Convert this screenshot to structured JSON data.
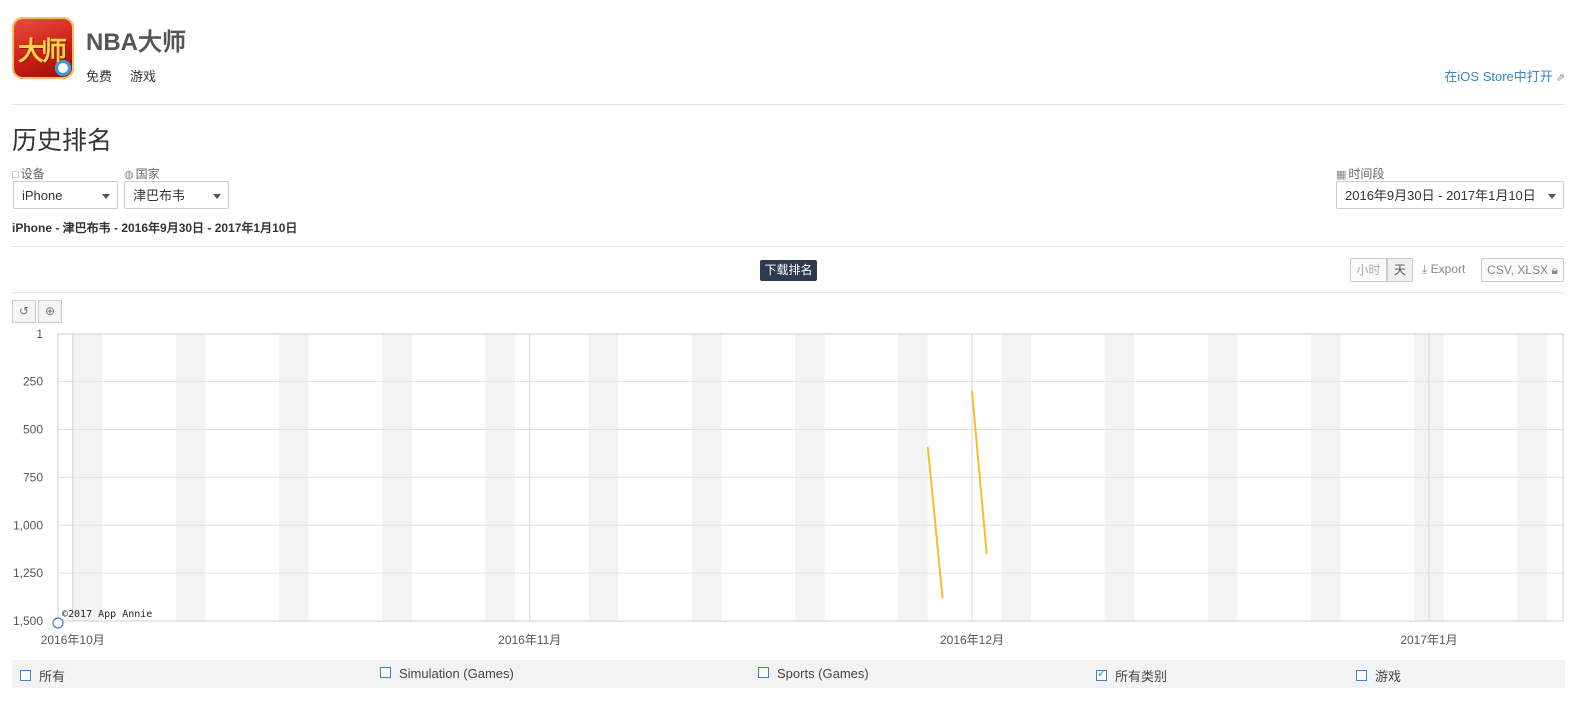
{
  "app": {
    "title": "NBA大师",
    "icon_name": "nba-master-app-icon",
    "icon_text": "大师",
    "price": "免费",
    "category": "游戏",
    "store_link": "在iOS Store中打开"
  },
  "section": {
    "title": "历史排名"
  },
  "filters": {
    "device_label": "设备",
    "device_value": "iPhone",
    "country_label": "国家",
    "country_value": "津巴布韦",
    "period_label": "时间段",
    "period_value": "2016年9月30日 - 2017年1月10日"
  },
  "summary": "iPhone - 津巴布韦 - 2016年9月30日 - 2017年1月10日",
  "toolbar": {
    "chart_button": "下载排名",
    "hour": "小时",
    "day": "天",
    "export": "Export",
    "csv": "CSV, XLSX"
  },
  "chart_data": {
    "type": "line",
    "title": "下载排名",
    "y_reversed": true,
    "ylim": [
      1,
      1500
    ],
    "y_ticks": [
      1,
      250,
      500,
      750,
      1000,
      1250,
      1500
    ],
    "y_tick_labels": [
      "1",
      "250",
      "500",
      "750",
      "1,000",
      "1,250",
      "1,500"
    ],
    "x_range": [
      "2016-09-30",
      "2017-01-10"
    ],
    "x_ticks": [
      {
        "date": "2016-10-01",
        "label": "2016年10月"
      },
      {
        "date": "2016-11-01",
        "label": "2016年11月"
      },
      {
        "date": "2016-12-01",
        "label": "2016年12月"
      },
      {
        "date": "2017-01-01",
        "label": "2017年1月"
      }
    ],
    "weekend_shading": true,
    "grid": true,
    "watermark": "©2017 App Annie",
    "series": [
      {
        "name": "所有类别",
        "color": "#f5c027",
        "segments": [
          [
            {
              "x": "2016-11-28",
              "y": 590
            },
            {
              "x": "2016-11-29",
              "y": 1380
            }
          ],
          [
            {
              "x": "2016-12-01",
              "y": 300
            },
            {
              "x": "2016-12-02",
              "y": 1150
            }
          ]
        ]
      }
    ]
  },
  "legend": [
    {
      "label": "所有",
      "checked": false
    },
    {
      "label": "Simulation (Games)",
      "checked": false
    },
    {
      "label": "Sports (Games)",
      "checked": false
    },
    {
      "label": "所有类别",
      "checked": true
    },
    {
      "label": "游戏",
      "checked": false
    }
  ]
}
